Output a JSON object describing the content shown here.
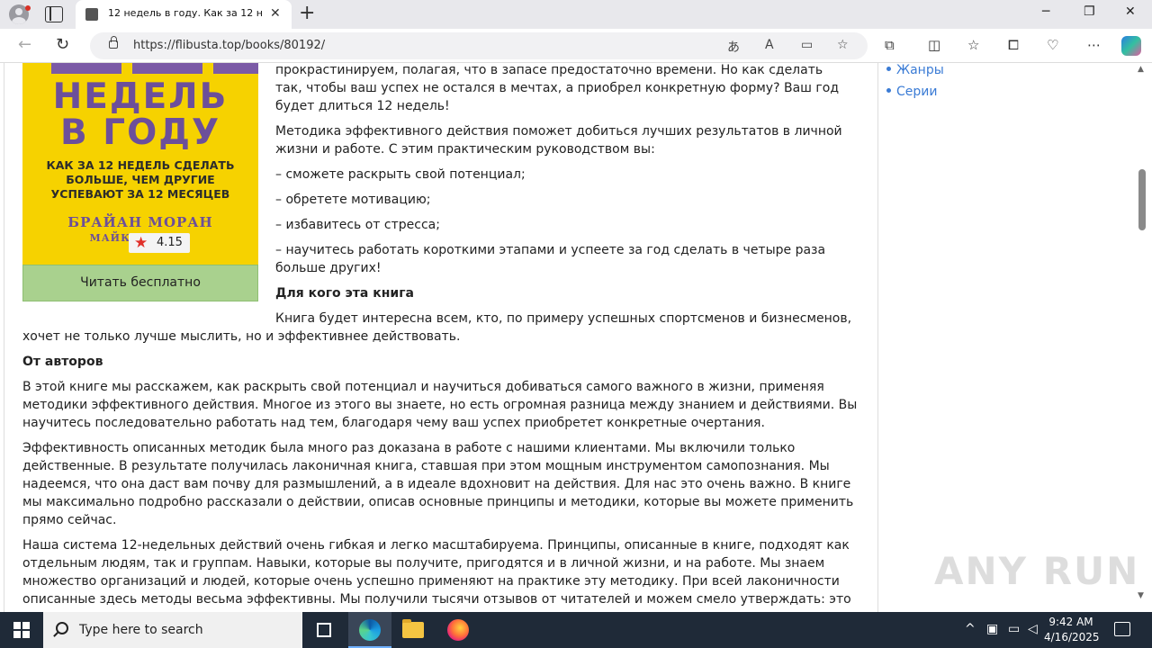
{
  "browser": {
    "tab_title": "12 недель в году. Как за 12 неде",
    "url": "https://flibusta.top/books/80192/",
    "new_tab": "+",
    "tab_close": "✕",
    "window": {
      "minimize": "─",
      "maximize": "❐",
      "close": "✕"
    }
  },
  "book": {
    "cover": {
      "title_line1": "НЕДЕЛЬ",
      "title_line2": "В ГОДУ",
      "subtitle_line1": "КАК ЗА 12 НЕДЕЛЬ СДЕЛАТЬ",
      "subtitle_line2": "БОЛЬШЕ, ЧЕМ ДРУГИЕ",
      "subtitle_line3": "УСПЕВАЮТ ЗА 12 МЕСЯЦЕВ",
      "author_line1": "БРАЙАН МОРАН",
      "author_line2": "МАЙК                ИНГТОН"
    },
    "rating": "4.15",
    "read_button": "Читать бесплатно"
  },
  "description": {
    "p_intro": "прокрастинируем, полагая, что в запасе предостаточно времени. Но как сделать так, чтобы ваш успех не остался в мечтах, а приобрел конкретную форму? Ваш год будет длиться 12 недель!",
    "p_method": "Методика эффективного действия поможет добиться лучших результатов в личной жизни и работе. С этим практическим руководством вы:",
    "bullet_1": "– сможете раскрыть свой потенциал;",
    "bullet_2": "– обретете мотивацию;",
    "bullet_3": "– избавитесь от стресса;",
    "bullet_4": "– научитесь работать короткими этапами и успеете за год сделать в четыре раза больше других!",
    "h_for_whom": "Для кого эта книга",
    "p_for_whom_1": "Книга будет интересна всем, кто, по примеру успешных спортсменов и бизнесменов,",
    "p_for_whom_2": "хочет не только лучше мыслить, но и эффективнее действовать.",
    "h_authors": "От авторов",
    "p_authors_1": "В этой книге мы расскажем, как раскрыть свой потенциал и научиться добиваться самого важного в жизни, применяя методики эффективного действия. Многое из этого вы знаете, но есть огромная разница между знанием и действиями. Вы научитесь последовательно работать над тем, благодаря чему ваш успех приобретет конкретные очертания.",
    "p_authors_2": "Эффективность описанных методик была много раз доказана в работе с нашими клиентами. Мы включили только действенные. В результате получилась лаконичная книга, ставшая при этом мощным инструментом самопознания. Мы надеемся, что она даст вам почву для размышлений, а в идеале вдохновит на действия. Для нас это очень важно. В книге мы максимально подробно рассказали о действии, описав основные принципы и методики, которые вы можете применить прямо сейчас.",
    "p_authors_3": "Наша система 12-недельных действий очень гибкая и легко масштабируема. Принципы, описанные в книге, подходят как отдельным людям, так и группам. Навыки, которые вы получите, пригодятся и в личной жизни, и на работе. Мы знаем множество организаций и людей, которые очень успешно применяют на практике эту методику. При всей лаконичности описанные здесь методы весьма эффективны. Мы получили тысячи отзывов от читателей и можем смело утверждать: это"
  },
  "sidebar": {
    "items": [
      {
        "label": "Жанры"
      },
      {
        "label": "Серии"
      }
    ]
  },
  "watermark": "ANY RUN",
  "taskbar": {
    "search_placeholder": "Type here to search",
    "time": "9:42 AM",
    "date": "4/16/2025"
  },
  "colors": {
    "link": "#3a7bd5",
    "read_button": "#a9d18e",
    "cover_bg": "#f6d200",
    "cover_purple": "#6c4f9a",
    "star": "#e0302a"
  }
}
